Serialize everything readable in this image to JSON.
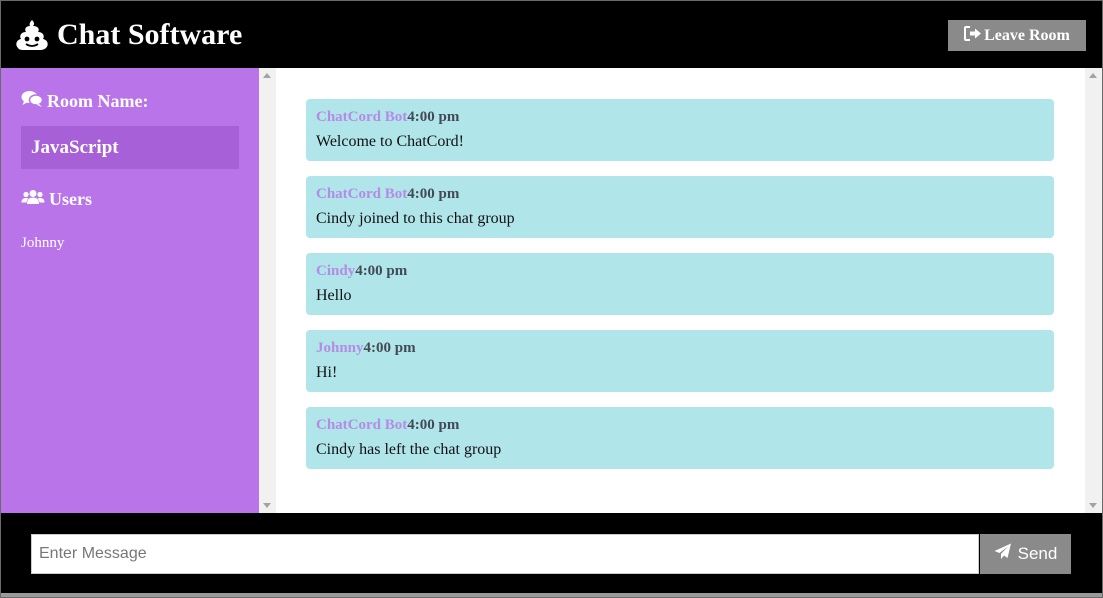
{
  "header": {
    "logo_icon": "poop-icon",
    "title": "Chat Software",
    "leave_button": {
      "label": "Leave Room",
      "icon": "sign-out-icon"
    }
  },
  "sidebar": {
    "room_heading": {
      "label": "Room Name:",
      "icon": "comments-icon"
    },
    "room_name": "JavaScript",
    "users_heading": {
      "label": "Users",
      "icon": "users-icon"
    },
    "users": [
      "Johnny"
    ]
  },
  "messages": [
    {
      "user": "ChatCord Bot",
      "time": "4:00 pm",
      "text": "Welcome to ChatCord!"
    },
    {
      "user": "ChatCord Bot",
      "time": "4:00 pm",
      "text": "Cindy joined to this chat group"
    },
    {
      "user": "Cindy",
      "time": "4:00 pm",
      "text": "Hello"
    },
    {
      "user": "Johnny",
      "time": "4:00 pm",
      "text": "Hi!"
    },
    {
      "user": "ChatCord Bot",
      "time": "4:00 pm",
      "text": "Cindy has left the chat group"
    }
  ],
  "composer": {
    "placeholder": "Enter Message",
    "value": "",
    "send_label": "Send",
    "send_icon": "paper-plane-icon"
  },
  "colors": {
    "header_bg": "#000000",
    "sidebar_bg": "#b974ea",
    "room_box_bg": "#a760d8",
    "message_bg": "#b0e5ea",
    "username_color": "#b68be6",
    "button_bg": "#8a8a8a"
  }
}
